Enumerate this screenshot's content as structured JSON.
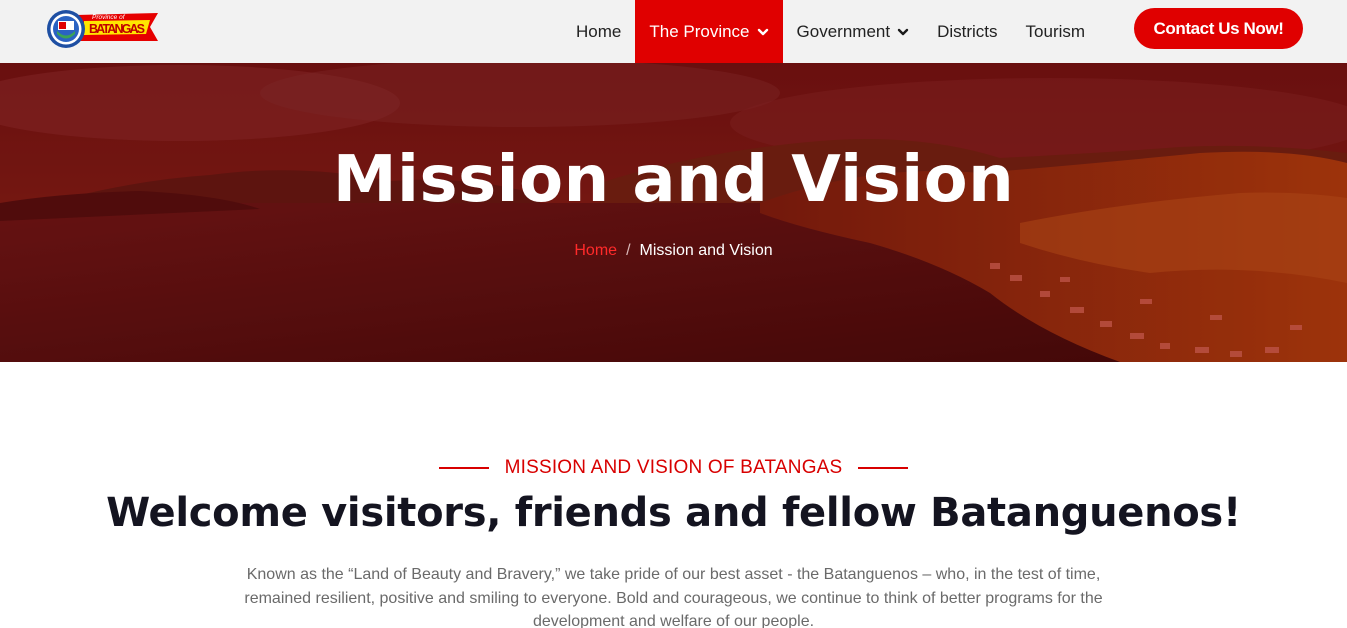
{
  "header": {
    "logo": {
      "icon": "batangas-seal-icon",
      "caption": "Province of",
      "name": "BATANGAS"
    },
    "nav": [
      {
        "label": "Home",
        "has_dropdown": false,
        "active": false
      },
      {
        "label": "The Province",
        "has_dropdown": true,
        "active": true
      },
      {
        "label": "Government",
        "has_dropdown": true,
        "active": false
      },
      {
        "label": "Districts",
        "has_dropdown": false,
        "active": false
      },
      {
        "label": "Tourism",
        "has_dropdown": false,
        "active": false
      }
    ],
    "contact_button": "Contact Us Now!"
  },
  "hero": {
    "title": "Mission and Vision",
    "breadcrumb": {
      "home": "Home",
      "separator": "/",
      "current": "Mission and Vision"
    }
  },
  "content": {
    "eyebrow": "MISSION AND VISION OF BATANGAS",
    "heading": "Welcome visitors, friends and fellow Batanguenos!",
    "intro": "Known as the “Land of Beauty and Bravery,” we take pride of our best asset - the Batanguenos – who, in the test of time, remained resilient, positive and smiling to everyone. Bold and courageous, we continue to think of better programs for the development and welfare of our people."
  },
  "colors": {
    "accent": "#e00000",
    "header_bg": "#f2f2f2",
    "hero_overlay": "#7a1010",
    "body_text": "#6a6a6a"
  }
}
